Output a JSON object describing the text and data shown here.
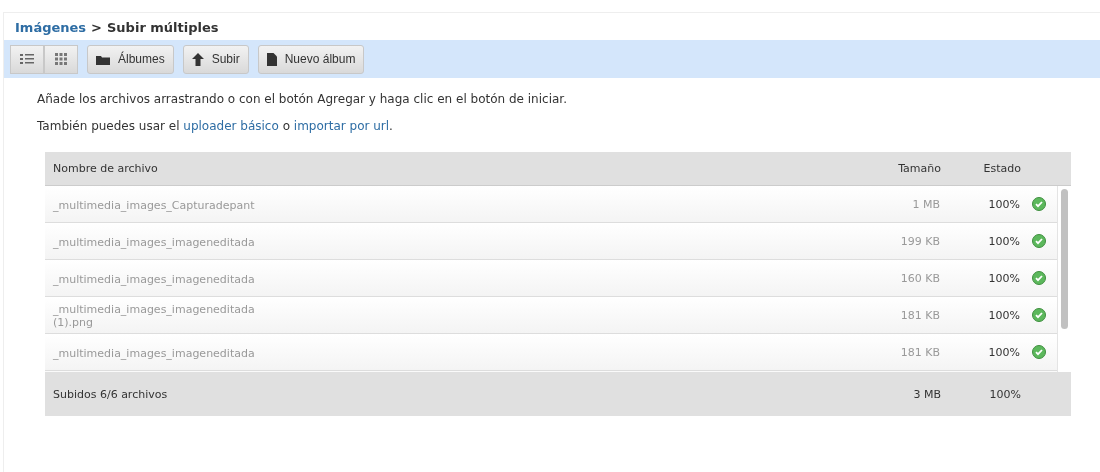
{
  "breadcrumb": {
    "parent": "Imágenes",
    "separator": ">",
    "current": "Subir múltiples"
  },
  "toolbar": {
    "view_buttons": [
      {
        "kind": "list"
      },
      {
        "kind": "grid"
      }
    ],
    "buttons": [
      {
        "kind": "folder",
        "label": "Álbumes"
      },
      {
        "kind": "upload",
        "label": "Subir"
      },
      {
        "kind": "file",
        "label": "Nuevo álbum"
      }
    ]
  },
  "instructions": "Añade los archivos arrastrando o con el botón Agregar y haga clic en el botón de iniciar.",
  "alternatives": {
    "before": "También puedes usar el",
    "link_1": "uploader básico",
    "middle": "o",
    "link_2": "importar por url",
    "after": "."
  },
  "table": {
    "columns": [
      "Nombre de archivo",
      "Tamaño",
      "Estado"
    ],
    "rows": [
      {
        "name": "_multimedia_images_Capturadepant",
        "size": "1 MB",
        "status": "100%",
        "done": true
      },
      {
        "name": "_multimedia_images_imageneditada",
        "size": "199 KB",
        "status": "100%",
        "done": true
      },
      {
        "name": "_multimedia_images_imageneditada",
        "size": "160 KB",
        "status": "100%",
        "done": true
      },
      {
        "name": "_multimedia_images_imageneditada\n(1).png",
        "size": "181 KB",
        "status": "100%",
        "done": true
      },
      {
        "name": "_multimedia_images_imageneditada",
        "size": "181 KB",
        "status": "100%",
        "done": true
      }
    ],
    "footer": {
      "summary": "Subidos 6/6 archivos",
      "size": "3 MB",
      "status": "100%"
    }
  }
}
